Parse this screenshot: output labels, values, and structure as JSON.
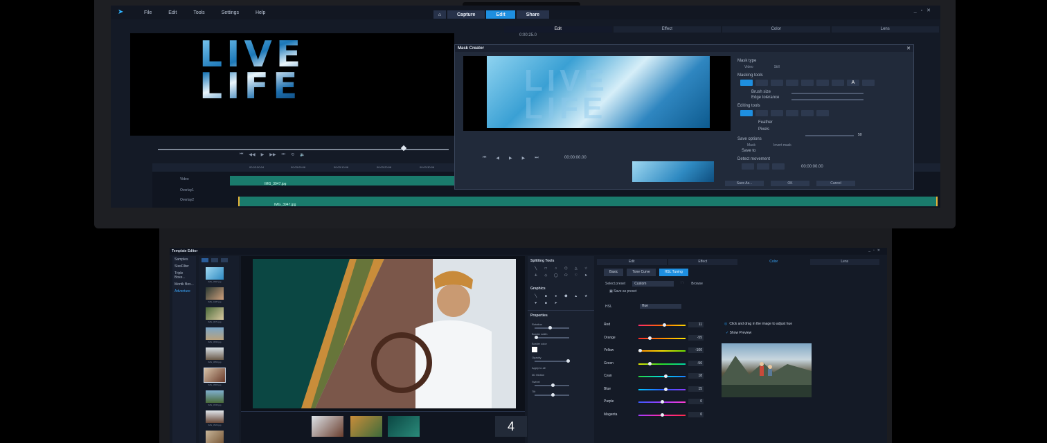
{
  "top": {
    "menu": [
      "File",
      "Edit",
      "Tools",
      "Settings",
      "Help"
    ],
    "modes": [
      "Capture",
      "Edit",
      "Share"
    ],
    "active_mode": "Edit",
    "edit_tabs": [
      "Edit",
      "Effect",
      "Color",
      "Lens"
    ],
    "timecode": "0:00:25.0",
    "preview_text": [
      "LIVE",
      "LIFE"
    ],
    "timeline": {
      "ruler": [
        "00:02:50:04",
        "00:03:00:06",
        "00:03:10:06",
        "00:03:20:06",
        "00:03:30:06",
        "00:03:36:06"
      ],
      "tracks": [
        {
          "label": "Video",
          "clip": "IMG_3947.jpg"
        },
        {
          "label": "Overlay1",
          "clip": ""
        },
        {
          "label": "Overlay2",
          "clip": "IMG_3947.jpg"
        }
      ]
    },
    "mask_creator": {
      "title": "Mask Creator",
      "timecode": "00:00:00.00",
      "mask_type_label": "Mask type",
      "mask_type_options": [
        "Video",
        "Still"
      ],
      "masking_tools_label": "Masking tools",
      "brush_size_label": "Brush size",
      "edge_tolerance_label": "Edge tolerance",
      "editing_tools_label": "Editing tools",
      "feather_label": "Feather",
      "pixels_label": "Pixels",
      "pixels_value": "50",
      "save_options_label": "Save options",
      "save_options": [
        "Mask",
        "Invert mask"
      ],
      "save_to_label": "Save to",
      "detect_movement_label": "Detect movement",
      "detect_tc": "00:00:00.00",
      "buttons": [
        "Save As...",
        "OK",
        "Cancel"
      ]
    }
  },
  "bottom": {
    "template_editor": {
      "title": "Template Editor",
      "categories": [
        "Samples",
        "SizeFilter",
        "Triple Boxe...",
        "Montk Box...",
        "Adventure"
      ],
      "active_category": "Adventure",
      "thumbs": [
        "IMG_3997.jpg",
        "IMG_4187.jpg",
        "IMG_3071.jpg",
        "IMG_3836.jpg",
        "IMG_3859.jpg",
        "IMG_3965.jpg",
        "IMG_3335.jpg",
        "IMG_3526.jpg",
        "IMG_3969.jpg"
      ],
      "strip_number": "4"
    },
    "split_panel": {
      "splitting_tools": "Splitting Tools",
      "graphics": "Graphics",
      "properties": "Properties",
      "props": [
        {
          "label": "Rotation",
          "value": "0"
        },
        {
          "label": "Border width",
          "value": "2"
        },
        {
          "label": "Border color",
          "value": ""
        },
        {
          "label": "Opacity",
          "value": "100"
        },
        {
          "label": "3D Motion",
          "value": ""
        },
        {
          "label": "Swivel",
          "value": "0"
        },
        {
          "label": "Tilt",
          "value": "0"
        }
      ],
      "apply_all": "Apply to all"
    },
    "color_panel": {
      "tabs": [
        "Edit",
        "Effect",
        "Color",
        "Lens"
      ],
      "active_tab": "Color",
      "subtabs": [
        "Basic",
        "Tone Curve",
        "HSL Tuning"
      ],
      "active_subtab": "HSL Tuning",
      "select_preset_label": "Select preset",
      "preset_value": "Custom",
      "browse": "Browse",
      "save_as_preset": "Save as preset",
      "hsl_label": "HSL",
      "hsl_mode": "Hue",
      "sliders": [
        {
          "label": "Red",
          "value": "11",
          "fraction": 0.56,
          "gradient": "linear-gradient(90deg,#ff2a6a,#ff6a00,#ffd600)"
        },
        {
          "label": "Orange",
          "value": "-55",
          "fraction": 0.23,
          "gradient": "linear-gradient(90deg,#ff2a2a,#ff8a00,#ffe600)"
        },
        {
          "label": "Yellow",
          "value": "-100",
          "fraction": 0.0,
          "gradient": "linear-gradient(90deg,#ff8a00,#ffe600,#6adf00)"
        },
        {
          "label": "Green",
          "value": "-56",
          "fraction": 0.22,
          "gradient": "linear-gradient(90deg,#e6e600,#2adf2a,#00d6a6)"
        },
        {
          "label": "Cyan",
          "value": "18",
          "fraction": 0.59,
          "gradient": "linear-gradient(90deg,#26d63c,#00d6e6,#1a7bff)"
        },
        {
          "label": "Blue",
          "value": "15",
          "fraction": 0.58,
          "gradient": "linear-gradient(90deg,#00c8ff,#2a5aff,#8a3cff)"
        },
        {
          "label": "Purple",
          "value": "0",
          "fraction": 0.5,
          "gradient": "linear-gradient(90deg,#3a5aff,#a03cff,#ff3ccf)"
        },
        {
          "label": "Magenta",
          "value": "0",
          "fraction": 0.5,
          "gradient": "linear-gradient(90deg,#a03cff,#ff2aa6,#ff2a4a)"
        }
      ],
      "hint": "Click and drag in the image to adjust hue",
      "show_preview": "Show Preview"
    }
  }
}
